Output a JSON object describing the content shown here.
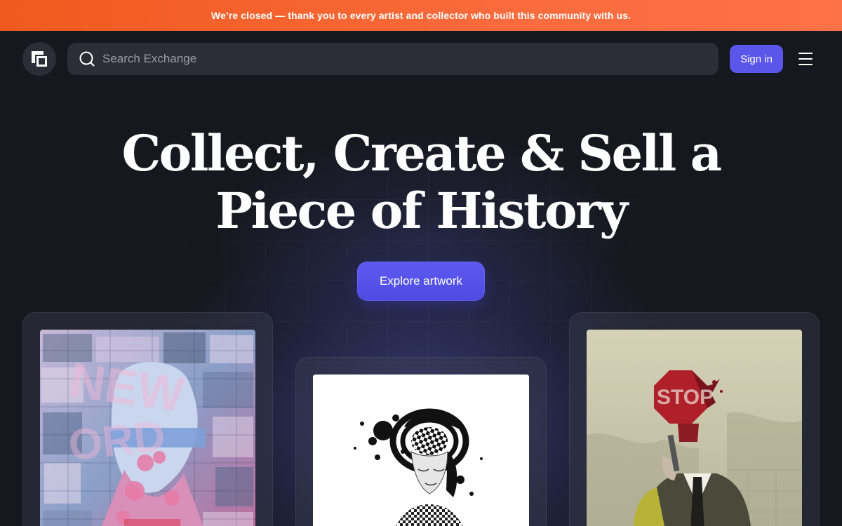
{
  "banner": {
    "text": "We’re closed — thank you to every artist and collector who built this community with us."
  },
  "header": {
    "logo_icon": "exchange-logo-icon",
    "search": {
      "placeholder": "Search Exchange",
      "value": "",
      "icon": "search-icon"
    },
    "sign_in_label": "Sign in",
    "menu_icon": "hamburger-menu-icon"
  },
  "hero": {
    "title_line1": "Collect, Create & Sell a",
    "title_line2": "Piece of History",
    "cta_label": "Explore artwork"
  },
  "artworks": [
    {
      "name": "collage-portrait-artwork"
    },
    {
      "name": "checkered-hat-portrait-artwork"
    },
    {
      "name": "stop-sign-head-artwork"
    }
  ],
  "colors": {
    "banner_start": "#f05a1e",
    "banner_end": "#fd7246",
    "accent": "#5b56ea",
    "background": "#16181f"
  }
}
